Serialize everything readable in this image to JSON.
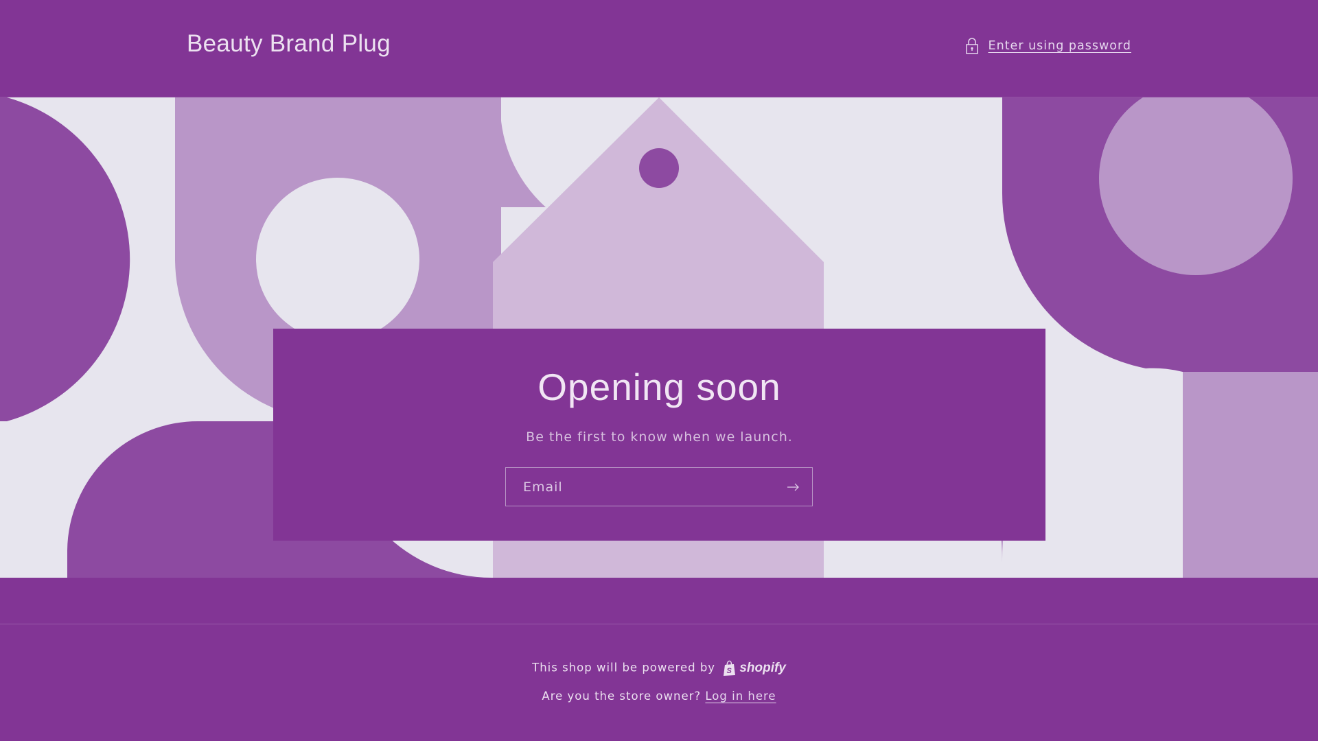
{
  "header": {
    "brand": "Beauty Brand Plug",
    "password_link": "Enter using password",
    "password_icon": "lock-icon"
  },
  "hero": {
    "title": "Opening soon",
    "subtitle": "Be the first to know when we launch.",
    "email_placeholder": "Email",
    "submit_icon": "arrow-right-icon"
  },
  "footer": {
    "powered_text": "This shop will be powered by",
    "shopify_label": "shopify",
    "owner_text": "Are you the store owner?",
    "login_link": "Log in here"
  },
  "colors": {
    "primary": "#823595",
    "shape_dark": "#8d4aa1",
    "shape_mid": "#b996c8",
    "shape_light": "#d0b8d9",
    "background_light": "#e7e5ee"
  }
}
